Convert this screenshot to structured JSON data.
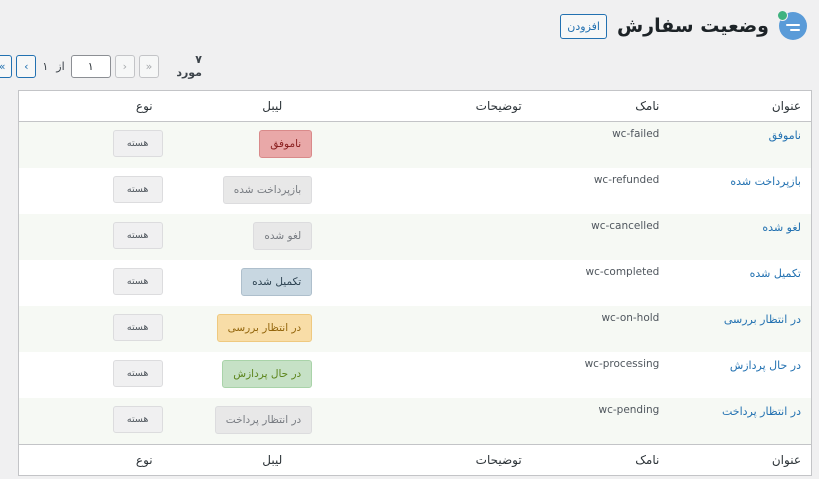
{
  "header": {
    "title": "وضعیت سفارش",
    "add_label": "افزودن",
    "icon": "chat-bubble-icon"
  },
  "pagination": {
    "count": "۷ مورد",
    "first": "«",
    "prev": "‹",
    "current": "۱",
    "of_label": "از",
    "total": "۱",
    "next": "›",
    "last": "»"
  },
  "columns": {
    "title": "عنوان",
    "slug": "نامک",
    "description": "توضیحات",
    "label": "لیبل",
    "type": "نوع"
  },
  "rows": [
    {
      "title": "ناموفق",
      "slug": "wc-failed",
      "description": "",
      "label": "ناموفق",
      "label_bg": "#e9a8a8",
      "label_border": "#d98a8a",
      "label_color": "#8a1f1f",
      "type": "هسته"
    },
    {
      "title": "بازپرداخت شده",
      "slug": "wc-refunded",
      "description": "",
      "label": "بازپرداخت شده",
      "label_bg": "#e8e8e8",
      "label_border": "#dcdcde",
      "label_color": "#787c82",
      "type": "هسته"
    },
    {
      "title": "لغو شده",
      "slug": "wc-cancelled",
      "description": "",
      "label": "لغو شده",
      "label_bg": "#e8e8e8",
      "label_border": "#dcdcde",
      "label_color": "#787c82",
      "type": "هسته"
    },
    {
      "title": "تکمیل شده",
      "slug": "wc-completed",
      "description": "",
      "label": "تکمیل شده",
      "label_bg": "#c8d7e1",
      "label_border": "#aebfcc",
      "label_color": "#2e4453",
      "type": "هسته"
    },
    {
      "title": "در انتظار بررسی",
      "slug": "wc-on-hold",
      "description": "",
      "label": "در انتظار بررسی",
      "label_bg": "#f8dda7",
      "label_border": "#efc97f",
      "label_color": "#94660c",
      "type": "هسته"
    },
    {
      "title": "در حال پردازش",
      "slug": "wc-processing",
      "description": "",
      "label": "در حال پردازش",
      "label_bg": "#c6e1c6",
      "label_border": "#a9d3a9",
      "label_color": "#5b841b",
      "type": "هسته"
    },
    {
      "title": "در انتظار پرداخت",
      "slug": "wc-pending",
      "description": "",
      "label": "در انتظار پرداخت",
      "label_bg": "#e8e8e8",
      "label_border": "#dcdcde",
      "label_color": "#787c82",
      "type": "هسته"
    }
  ]
}
